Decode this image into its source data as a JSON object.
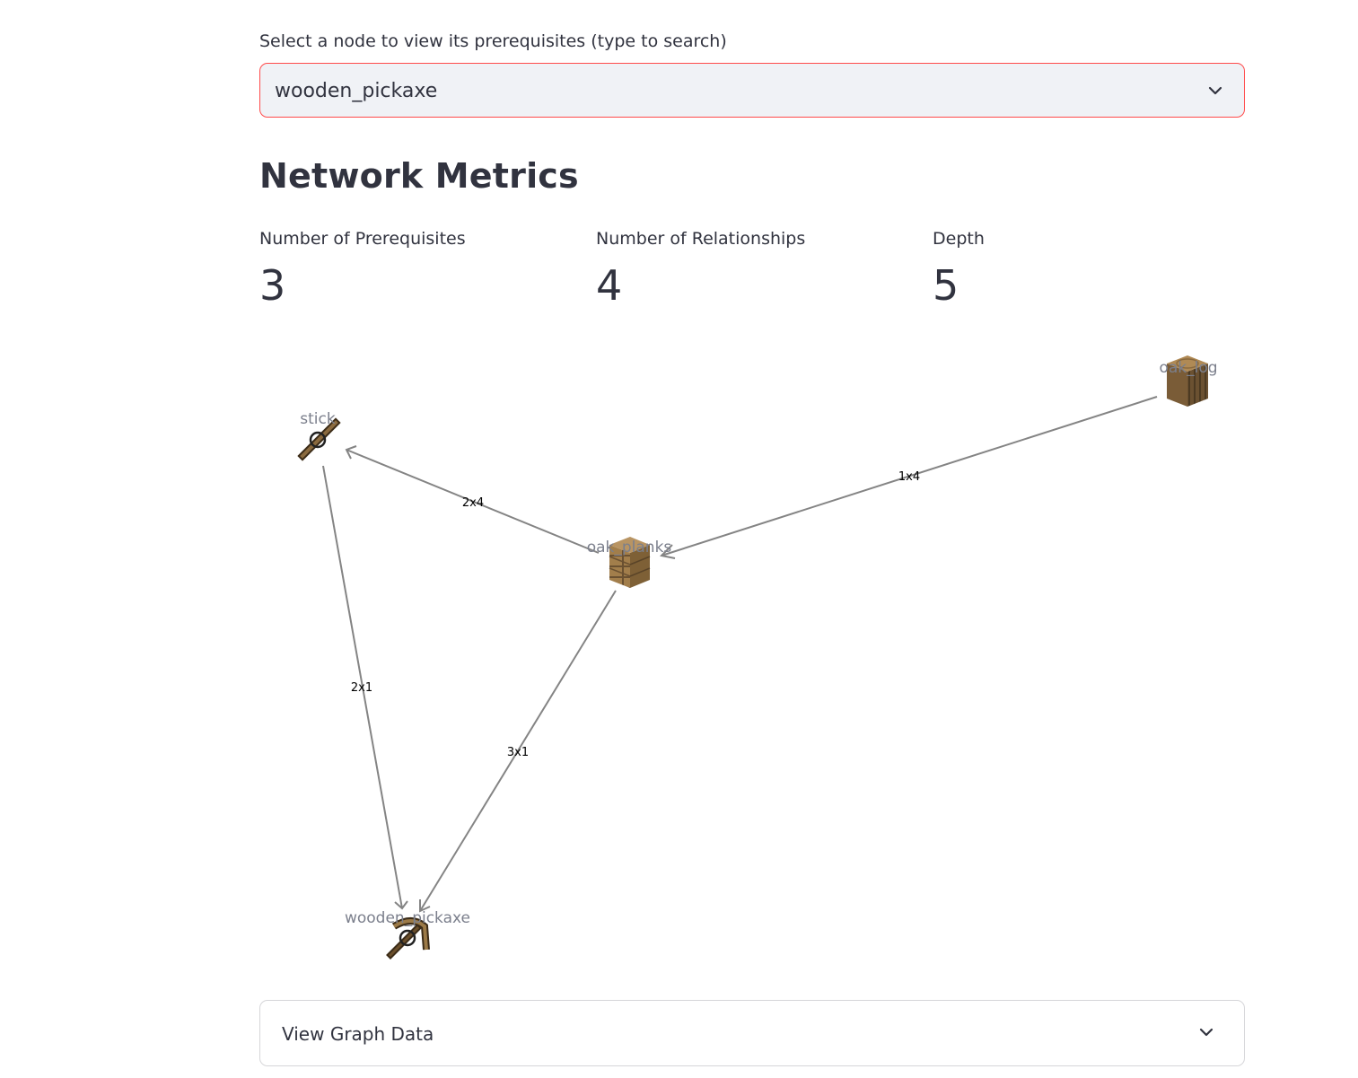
{
  "selector": {
    "label": "Select a node to view its prerequisites (type to search)",
    "value": "wooden_pickaxe",
    "icon": "chevron-down-icon"
  },
  "metrics": {
    "title": "Network Metrics",
    "items": [
      {
        "label": "Number of Prerequisites",
        "value": "3"
      },
      {
        "label": "Number of Relationships",
        "value": "4"
      },
      {
        "label": "Depth",
        "value": "5"
      }
    ]
  },
  "graph": {
    "nodes": [
      {
        "id": "stick",
        "label": "stick",
        "icon": "stick-item-icon"
      },
      {
        "id": "oak_log",
        "label": "oak_log",
        "icon": "oak-log-block-icon"
      },
      {
        "id": "oak_planks",
        "label": "oak_planks",
        "icon": "oak-planks-block-icon"
      },
      {
        "id": "wooden_pickaxe",
        "label": "wooden_pickaxe",
        "icon": "wooden-pickaxe-item-icon"
      }
    ],
    "edges": [
      {
        "from": "oak_log",
        "to": "oak_planks",
        "label": "1x4"
      },
      {
        "from": "oak_planks",
        "to": "stick",
        "label": "2x4"
      },
      {
        "from": "stick",
        "to": "wooden_pickaxe",
        "label": "2x1"
      },
      {
        "from": "oak_planks",
        "to": "wooden_pickaxe",
        "label": "3x1"
      }
    ],
    "colors": {
      "edge": "#848484",
      "node_label": "#7b7f8c",
      "edge_label": "#000000"
    }
  },
  "expander": {
    "label": "View Graph Data",
    "icon": "chevron-down-icon"
  }
}
